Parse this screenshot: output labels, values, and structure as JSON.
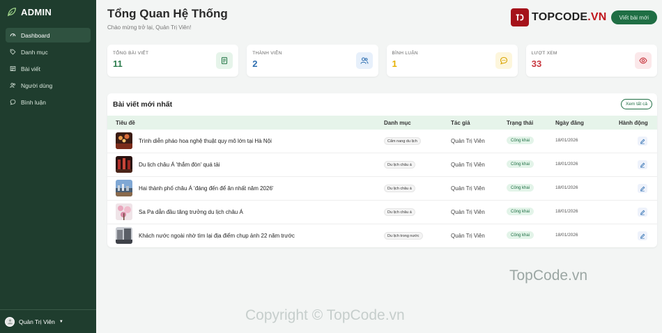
{
  "sidebar": {
    "brand": "ADMIN",
    "items": [
      {
        "label": "Dashboard",
        "icon": "dashboard-icon",
        "active": true
      },
      {
        "label": "Danh mục",
        "icon": "tag-icon",
        "active": false
      },
      {
        "label": "Bài viết",
        "icon": "newspaper-icon",
        "active": false
      },
      {
        "label": "Người dùng",
        "icon": "users-icon",
        "active": false
      },
      {
        "label": "Bình luận",
        "icon": "comment-icon",
        "active": false
      }
    ],
    "user": "Quản Trị Viên"
  },
  "header": {
    "title": "Tổng Quan Hệ Thống",
    "subtitle": "Chào mừng trở lại, Quản Trị Viên!",
    "logo_prefix": "TOPCODE",
    "logo_suffix": ".VN",
    "button_label": "Viết bài mới"
  },
  "stats": [
    {
      "label": "Tổng bài viết",
      "value": "11",
      "color": "#2e7d4f",
      "bg": "#e6f4ea",
      "icon": "article-icon"
    },
    {
      "label": "Thành viên",
      "value": "2",
      "color": "#2f6fb0",
      "bg": "#e7f0fb",
      "icon": "users-icon"
    },
    {
      "label": "Bình luận",
      "value": "1",
      "color": "#e6b100",
      "bg": "#fdf6dc",
      "icon": "comment-icon"
    },
    {
      "label": "Lượt xem",
      "value": "33",
      "color": "#c8373f",
      "bg": "#fbe8ea",
      "icon": "eye-icon"
    }
  ],
  "latest": {
    "title": "Bài viết mới nhất",
    "view_all": "Xem tất cả",
    "columns": [
      "Tiêu đề",
      "Danh mục",
      "Tác giả",
      "Trạng thái",
      "Ngày đăng",
      "Hành động"
    ],
    "rows": [
      {
        "title": "Trình diễn pháo hoa nghệ thuật quy mô lớn tại Hà Nội",
        "category": "Cẩm nang du lịch",
        "author": "Quản Trị Viên",
        "status": "Công khai",
        "date": "18/01/2026"
      },
      {
        "title": "Du lịch châu Á 'thắm đòn' quá tải",
        "category": "Du lịch châu á",
        "author": "Quản Trị Viên",
        "status": "Công khai",
        "date": "18/01/2026"
      },
      {
        "title": "Hai thành phố châu Á 'đáng đến để ăn nhất năm 2026'",
        "category": "Du lịch châu á",
        "author": "Quản Trị Viên",
        "status": "Công khai",
        "date": "18/01/2026"
      },
      {
        "title": "Sa Pa dẫn đầu tăng trưởng du lịch châu Á",
        "category": "Du lịch châu á",
        "author": "Quản Trị Viên",
        "status": "Công khai",
        "date": "18/01/2026"
      },
      {
        "title": "Khách nước ngoài nhờ tìm lại địa điểm chụp ảnh 22 năm trước",
        "category": "Du lịch trong nước",
        "author": "Quản Trị Viên",
        "status": "Công khai",
        "date": "18/01/2026"
      }
    ]
  },
  "watermarks": [
    "TopCode.vn",
    "Copyright © TopCode.vn"
  ]
}
